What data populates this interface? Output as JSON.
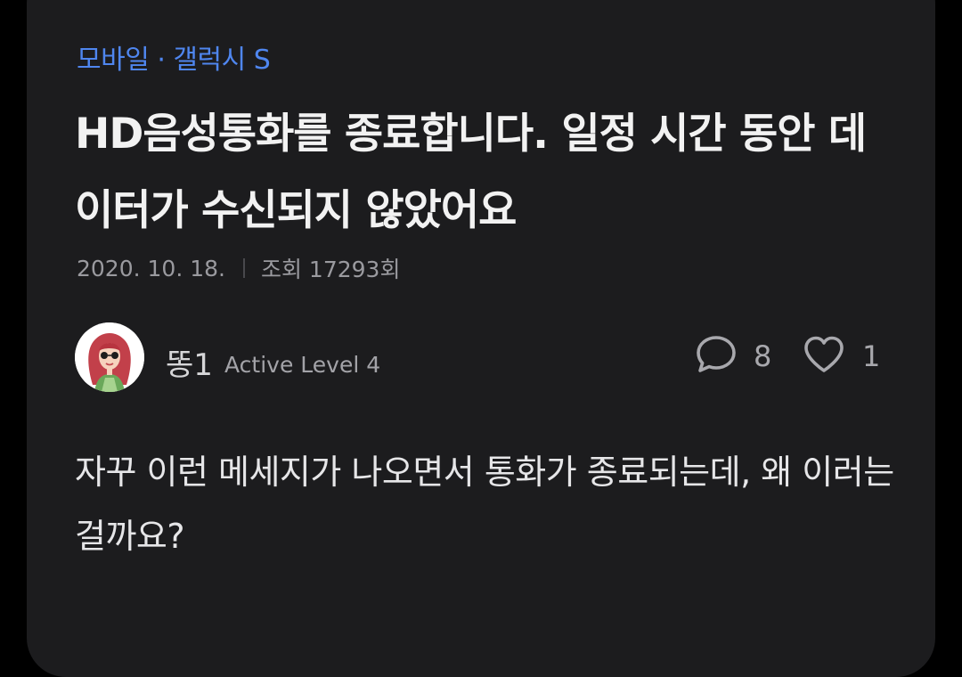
{
  "post": {
    "category": "모바일 · 갤럭시 S",
    "title": "HD음성통화를 종료합니다. 일정 시간 동안 데이터가 수신되지 않았어요",
    "date": "2020. 10. 18.",
    "views": "조회 17293회",
    "author": {
      "name": "똥1",
      "level": "Active Level 4"
    },
    "stats": {
      "comments": "8",
      "likes": "1"
    },
    "body": "자꾸 이런 메세지가 나오면서 통화가 종료되는데, 왜 이러는걸까요?"
  },
  "icons": {
    "comment": "speech-bubble-icon",
    "like": "heart-outline-icon"
  },
  "colors": {
    "background": "#000000",
    "card": "#1c1c1e",
    "accent": "#4f86ef",
    "title": "#f2f2f2",
    "muted": "#9a9a9f"
  }
}
